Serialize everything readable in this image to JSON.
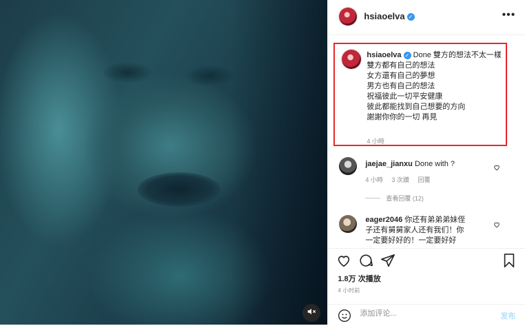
{
  "media": {
    "mute_icon": "speaker-muted-icon"
  },
  "header": {
    "username": "hsiaoelva",
    "verified_icon": "verified-badge-icon",
    "more_icon": "more-options-icon"
  },
  "caption": {
    "username": "hsiaoelva",
    "first_line": "Done 雙方的想法不太一樣",
    "lines": [
      "雙方都有自己的想法",
      "女方還有自己的夢想",
      "男方也有自己的想法",
      "祝福彼此一切平安健康",
      "彼此都能找到自己想要的方向",
      "謝謝你你的一切 再見"
    ],
    "time": "4 小時"
  },
  "comments": [
    {
      "username": "jaejae_jianxu",
      "text": "Done with ?",
      "time": "4 小時",
      "likes": "3 次讚",
      "reply": "回覆",
      "view_replies": "查看回覆 (12)"
    },
    {
      "username": "eager2046",
      "text": "你还有弟弟弟妹侄子还有舅舅家人还有我们！你一定要好好的！一定要好好的！你不是蝴"
    }
  ],
  "actions": {
    "like_icon": "heart-icon",
    "comment_icon": "comment-bubble-icon",
    "share_icon": "paper-plane-icon",
    "save_icon": "bookmark-icon"
  },
  "stats": {
    "views": "1.8万 次播放",
    "post_time": "4 小时前"
  },
  "add_comment": {
    "placeholder": "添加评论...",
    "post_label": "发布",
    "emoji_icon": "emoji-smiley-icon"
  },
  "colors": {
    "highlight_border": "#e5262b",
    "verified_blue": "#3897f0",
    "post_button_disabled": "#b2dffc"
  }
}
